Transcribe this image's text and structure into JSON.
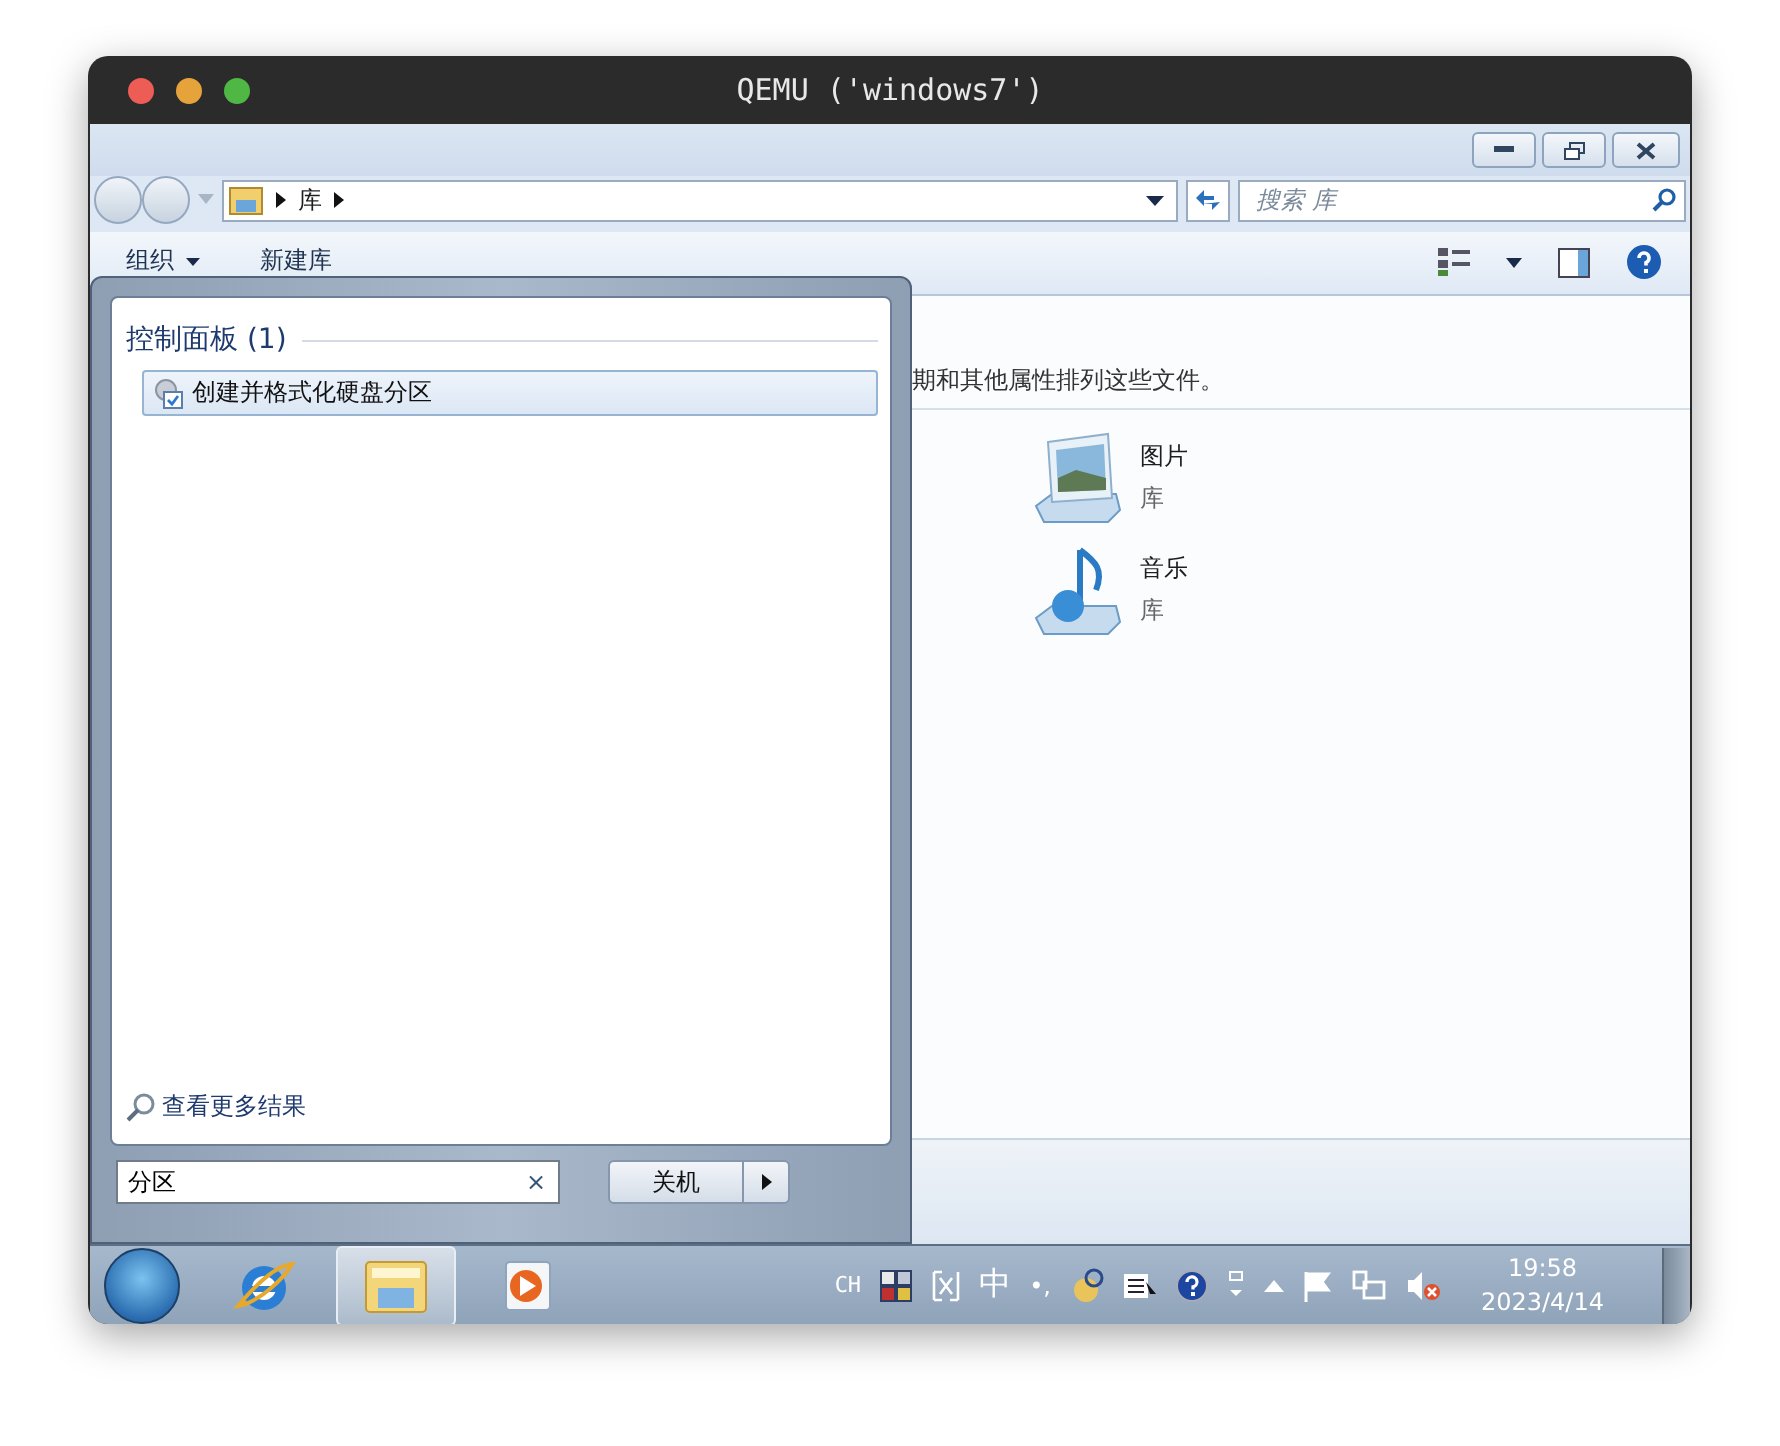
{
  "window": {
    "title": "QEMU ('windows7')"
  },
  "explorer": {
    "address": {
      "crumbs": [
        "库"
      ]
    },
    "search": {
      "placeholder": "搜索 库"
    },
    "toolbar": [
      {
        "label": "组织",
        "kind": "menu"
      },
      {
        "label": "新建库",
        "kind": "button"
      }
    ],
    "info": "期和其他属性排列这些文件。",
    "libraries": [
      {
        "name": "图片",
        "type_label": "库",
        "kind": "pictures"
      },
      {
        "name": "音乐",
        "type_label": "库",
        "kind": "music"
      }
    ]
  },
  "start_menu": {
    "group_title": "控制面板 (1)",
    "results": [
      {
        "label": "创建并格式化硬盘分区",
        "selected": true
      }
    ],
    "more_results": "查看更多结果",
    "search": {
      "value": "分区",
      "clear": "×"
    },
    "shutdown": "关机"
  },
  "taskbar": {
    "apps": [
      {
        "kind": "ie",
        "selected": false
      },
      {
        "kind": "explorer",
        "selected": true
      },
      {
        "kind": "media",
        "selected": false
      }
    ],
    "tray": {
      "language": "CH",
      "ime": "中",
      "punct": "•,",
      "time": "19:58",
      "date": "2023/4/14"
    }
  }
}
